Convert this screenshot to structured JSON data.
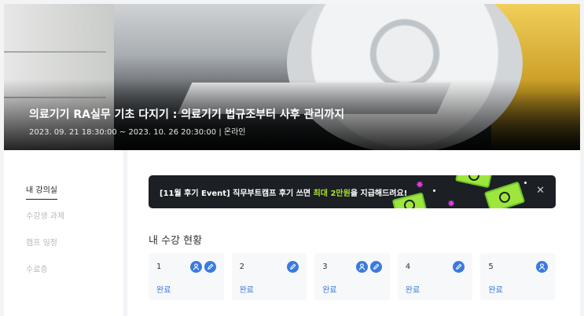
{
  "hero": {
    "title": "의료기기 RA실무 기초 다지기 : 의료기기 법규조부터 사후 관리까지",
    "date": "2023. 09. 21 18:30:00 ~ 2023. 10. 26 20:30:00 | 온라인"
  },
  "sidebar": {
    "items": [
      {
        "label": "내 강의실",
        "active": true
      },
      {
        "label": "수강생 과제",
        "active": false
      },
      {
        "label": "캠프 일정",
        "active": false
      },
      {
        "label": "수료증",
        "active": false
      }
    ]
  },
  "banner": {
    "text_prefix": "[11월 후기 Event] 직무부트캠프 후기 쓰면 ",
    "text_highlight": "최대 2만원",
    "text_suffix": "을 지급해드려요!",
    "close_icon": "close-icon",
    "accent_color": "#a6e22e"
  },
  "section": {
    "title": "내 수강 현황"
  },
  "cards": [
    {
      "num": "1",
      "status": "완료",
      "icons": [
        "person-icon",
        "pencil-icon"
      ]
    },
    {
      "num": "2",
      "status": "완료",
      "icons": [
        "pencil-icon"
      ]
    },
    {
      "num": "3",
      "status": "완료",
      "icons": [
        "person-icon",
        "pencil-icon"
      ]
    },
    {
      "num": "4",
      "status": "완료",
      "icons": [
        "pencil-icon"
      ]
    },
    {
      "num": "5",
      "status": "완료",
      "icons": [
        "person-icon"
      ]
    }
  ],
  "colors": {
    "status_blue": "#3a7ae0",
    "banner_bg": "#1c1f24"
  }
}
